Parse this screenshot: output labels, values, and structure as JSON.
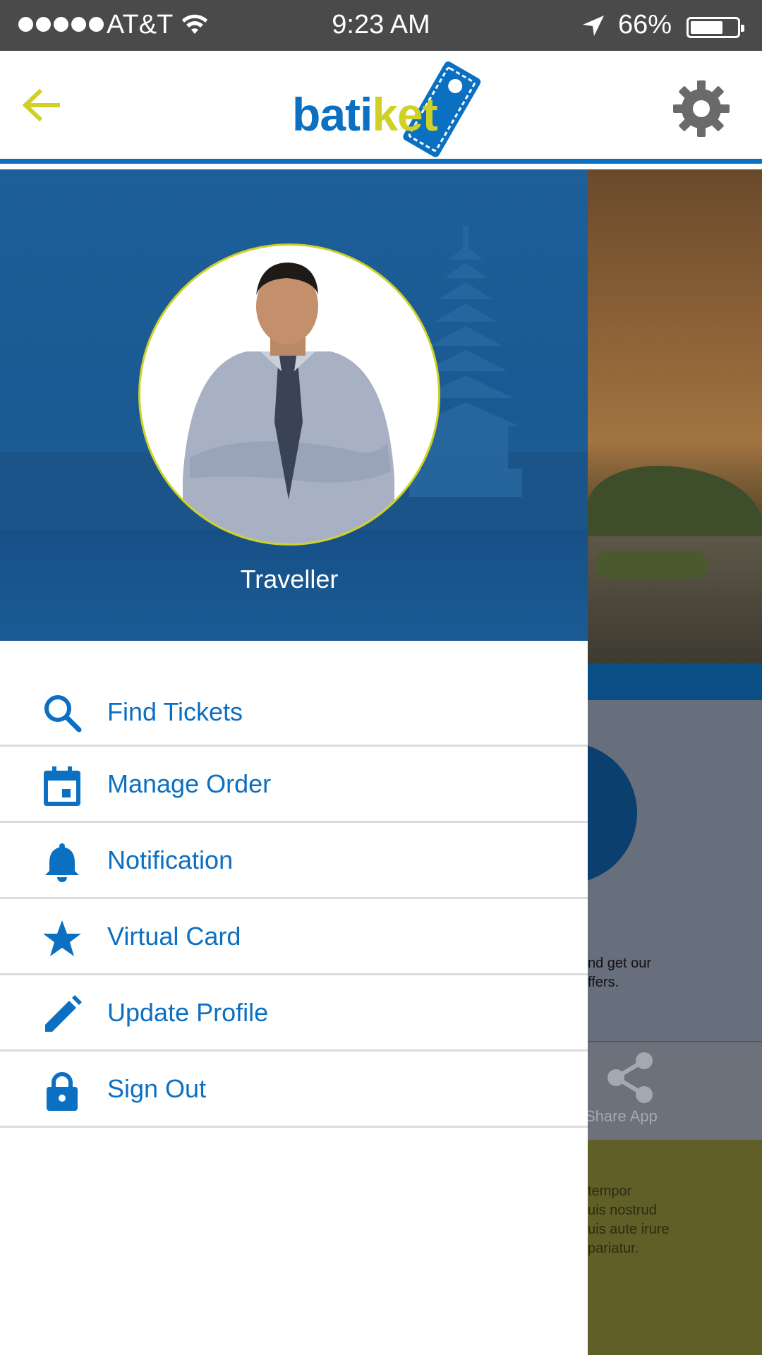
{
  "status_bar": {
    "carrier": "AT&T",
    "time": "9:23 AM",
    "battery_percent": "66%",
    "icons": [
      "signal-dots",
      "wifi-icon",
      "location-arrow-icon",
      "battery-icon"
    ]
  },
  "header": {
    "back_icon": "arrow-left-icon",
    "logo_part1": "bati",
    "logo_part2": "ket",
    "settings_icon": "gear-icon"
  },
  "drawer": {
    "profile_name": "Traveller",
    "menu": [
      {
        "label": "Find Tickets",
        "icon": "search-icon"
      },
      {
        "label": "Manage Order",
        "icon": "calendar-icon"
      },
      {
        "label": "Notification",
        "icon": "bell-icon"
      },
      {
        "label": "Virtual Card",
        "icon": "star-icon"
      },
      {
        "label": "Update Profile",
        "icon": "pencil-icon"
      },
      {
        "label": "Sign Out",
        "icon": "lock-icon"
      }
    ]
  },
  "background": {
    "promo_line1": "nd get our",
    "promo_line2": "ffers.",
    "share_label": "Share App",
    "lorem_line1": "tempor",
    "lorem_line2": "uis nostrud",
    "lorem_line3": "uis aute irure",
    "lorem_line4": "pariatur."
  },
  "colors": {
    "brand_blue": "#0b6fc2",
    "brand_yellow": "#cfd127",
    "status_bar": "#4a4a4a",
    "divider": "#dcdcdc"
  }
}
